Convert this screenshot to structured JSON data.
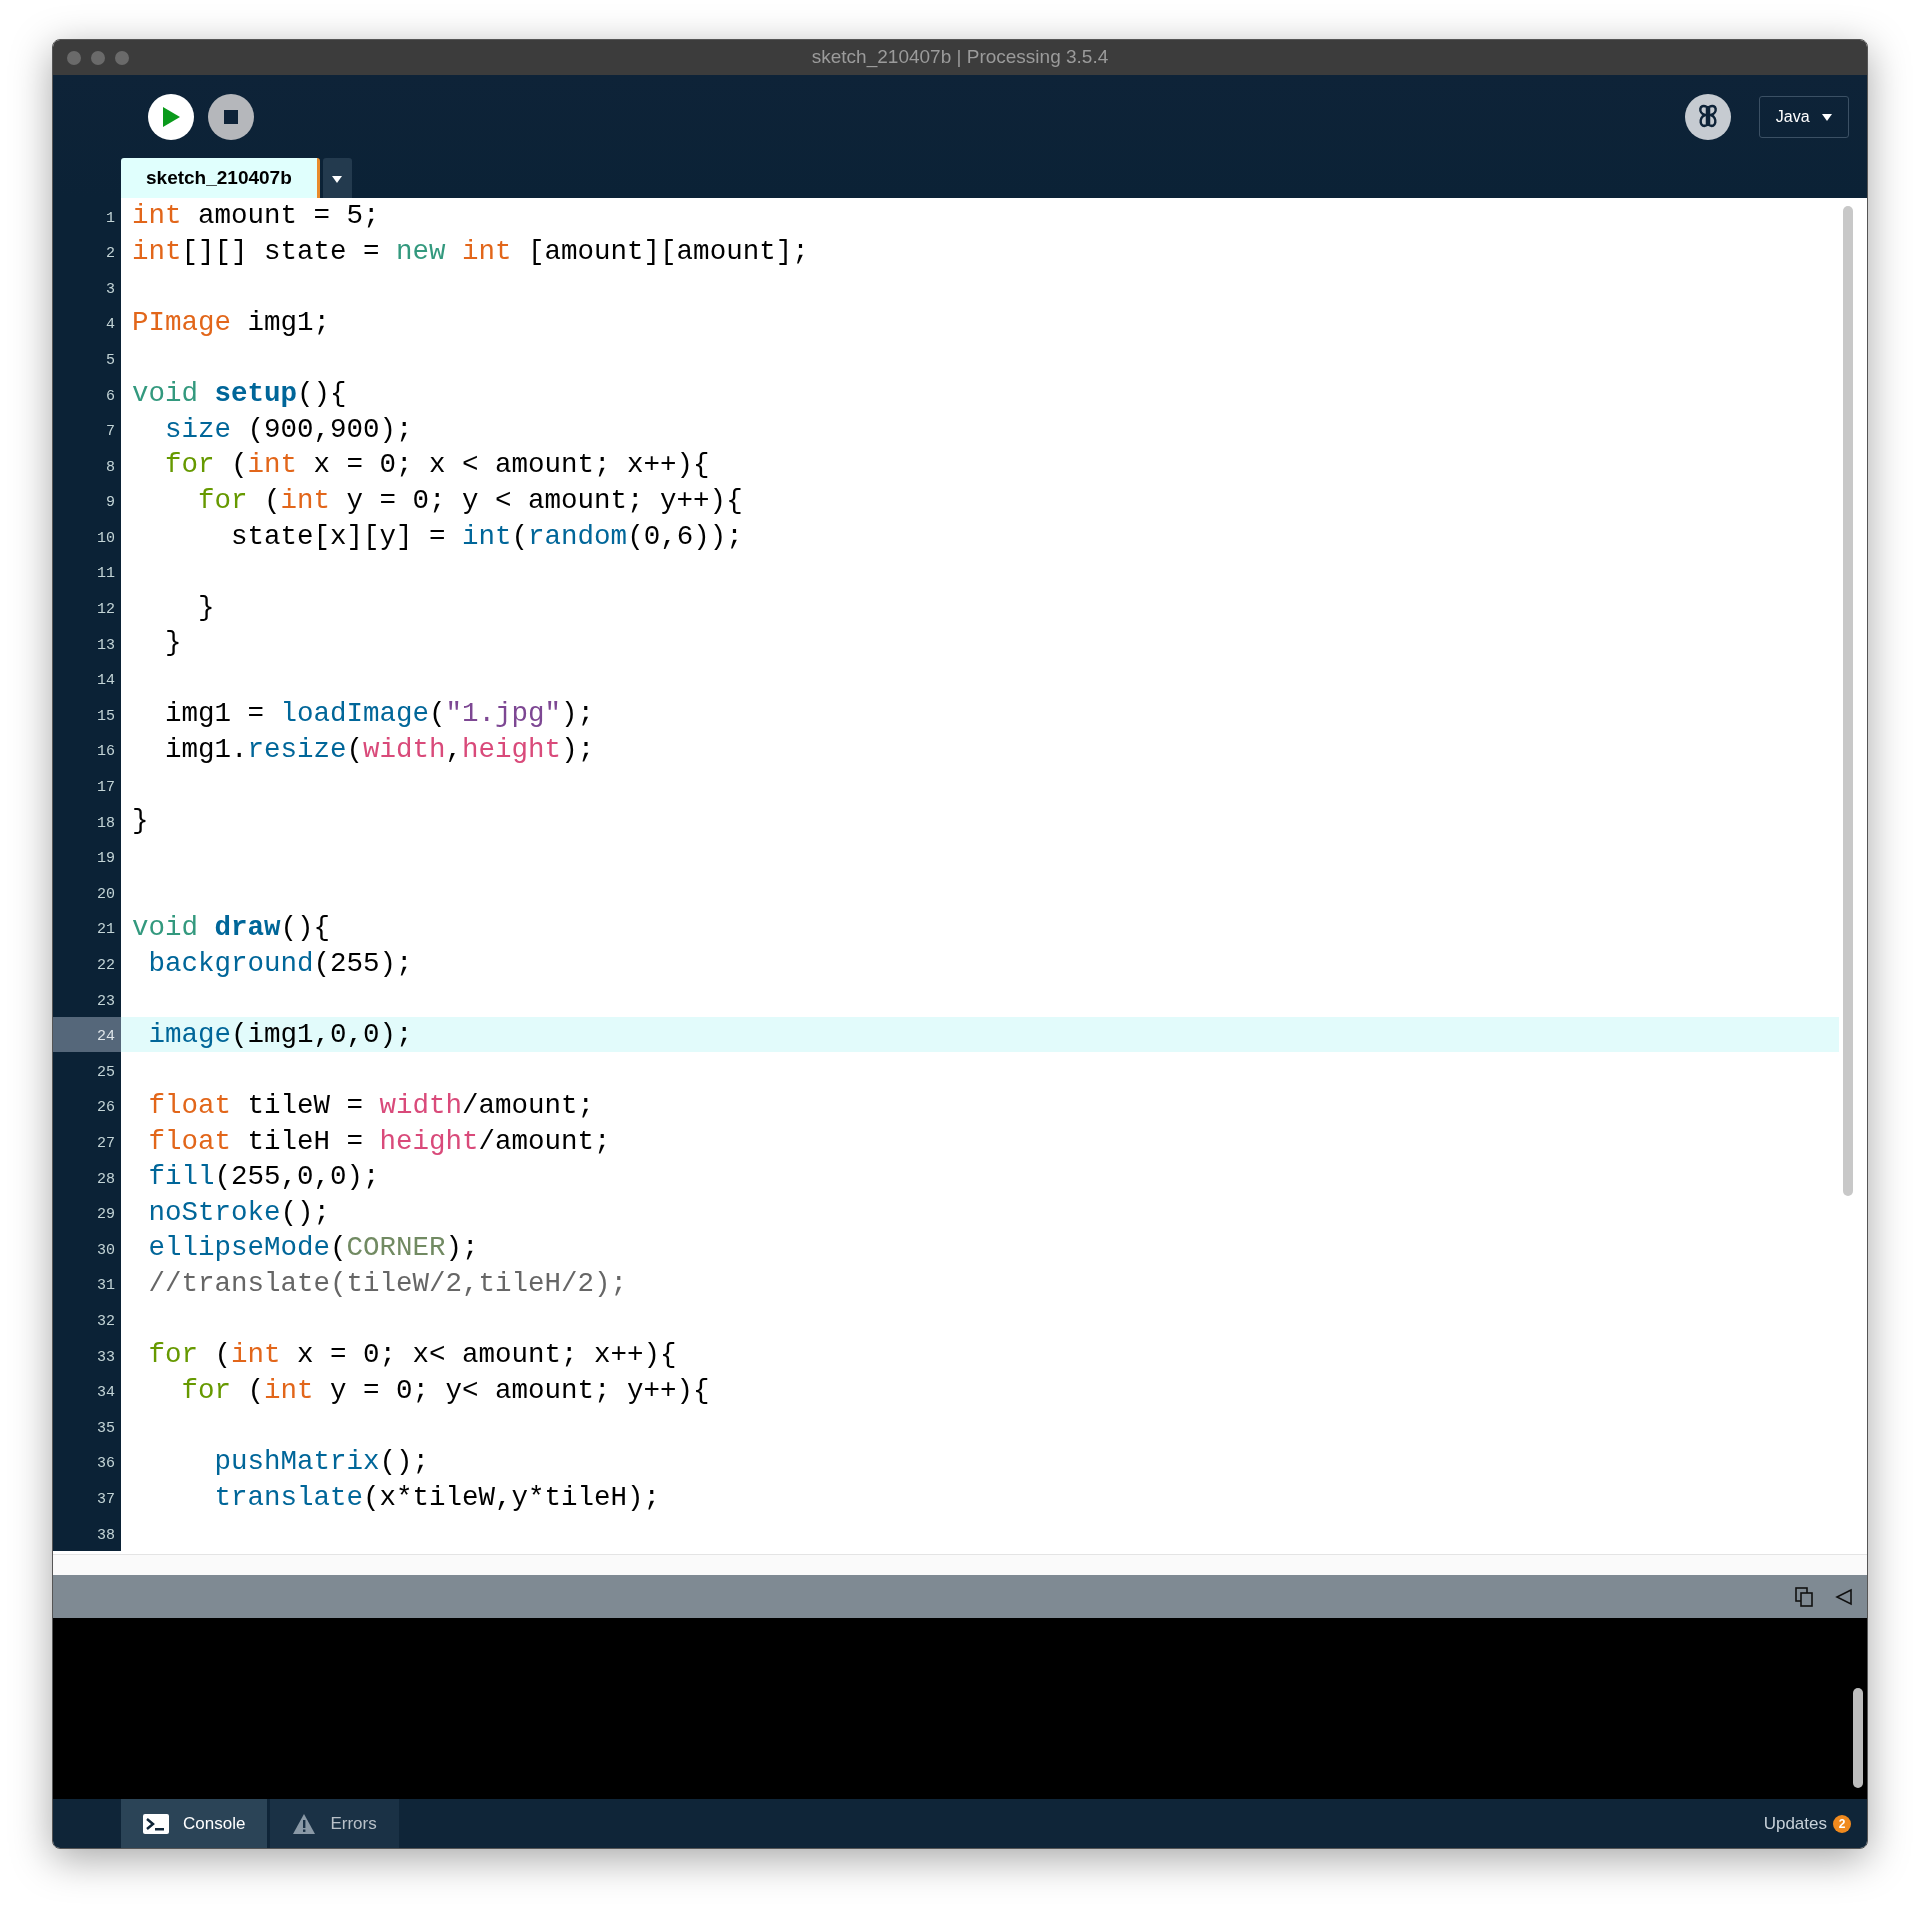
{
  "window": {
    "title": "sketch_210407b | Processing 3.5.4"
  },
  "toolbar": {
    "mode": "Java"
  },
  "tabs": [
    {
      "label": "sketch_210407b",
      "selected": true
    }
  ],
  "editor": {
    "lines": [
      {
        "number": "1",
        "current": false,
        "tokens": [
          {
            "kind": "type",
            "text": "int"
          },
          {
            "kind": "plain",
            "text": " amount = 5;"
          }
        ]
      },
      {
        "number": "2",
        "current": false,
        "tokens": [
          {
            "kind": "type",
            "text": "int"
          },
          {
            "kind": "plain",
            "text": "[][] state = "
          },
          {
            "kind": "keyword",
            "text": "new "
          },
          {
            "kind": "type",
            "text": "int"
          },
          {
            "kind": "plain",
            "text": " [amount][amount];"
          }
        ]
      },
      {
        "number": "3",
        "current": false
      },
      {
        "number": "4",
        "current": false,
        "tokens": [
          {
            "kind": "type",
            "text": "PImage"
          },
          {
            "kind": "plain",
            "text": " img1;"
          }
        ]
      },
      {
        "number": "5",
        "current": false
      },
      {
        "number": "6",
        "current": false,
        "tokens": [
          {
            "kind": "keyword",
            "text": "void "
          },
          {
            "kind": "method",
            "text": "setup"
          },
          {
            "kind": "plain",
            "text": "(){"
          }
        ]
      },
      {
        "number": "7",
        "current": false,
        "tokens": [
          {
            "kind": "function",
            "text": "  size"
          },
          {
            "kind": "plain",
            "text": " (900,900);"
          }
        ]
      },
      {
        "number": "8",
        "current": false,
        "tokens": [
          {
            "kind": "control",
            "text": "  for"
          },
          {
            "kind": "plain",
            "text": " ("
          },
          {
            "kind": "type",
            "text": "int"
          },
          {
            "kind": "plain",
            "text": " x = 0; x < amount; x++){"
          }
        ]
      },
      {
        "number": "9",
        "current": false,
        "tokens": [
          {
            "kind": "control",
            "text": "    for"
          },
          {
            "kind": "plain",
            "text": " ("
          },
          {
            "kind": "type",
            "text": "int"
          },
          {
            "kind": "plain",
            "text": " y = 0; y < amount; y++){"
          }
        ]
      },
      {
        "number": "10",
        "current": false,
        "tokens": [
          {
            "kind": "plain",
            "text": "      state[x][y] = "
          },
          {
            "kind": "function",
            "text": "int"
          },
          {
            "kind": "plain",
            "text": "("
          },
          {
            "kind": "function",
            "text": "random"
          },
          {
            "kind": "plain",
            "text": "(0,6));"
          }
        ]
      },
      {
        "number": "11",
        "current": false
      },
      {
        "number": "12",
        "current": false,
        "tokens": [
          {
            "kind": "plain",
            "text": "    }"
          }
        ]
      },
      {
        "number": "13",
        "current": false,
        "tokens": [
          {
            "kind": "plain",
            "text": "  }"
          }
        ]
      },
      {
        "number": "14",
        "current": false
      },
      {
        "number": "15",
        "current": false,
        "tokens": [
          {
            "kind": "plain",
            "text": "  img1 = "
          },
          {
            "kind": "function",
            "text": "loadImage"
          },
          {
            "kind": "plain",
            "text": "("
          },
          {
            "kind": "string",
            "text": "\"1.jpg\""
          },
          {
            "kind": "plain",
            "text": ");"
          }
        ]
      },
      {
        "number": "16",
        "current": false,
        "tokens": [
          {
            "kind": "plain",
            "text": "  img1."
          },
          {
            "kind": "function",
            "text": "resize"
          },
          {
            "kind": "plain",
            "text": "("
          },
          {
            "kind": "variable",
            "text": "width"
          },
          {
            "kind": "plain",
            "text": ","
          },
          {
            "kind": "variable",
            "text": "height"
          },
          {
            "kind": "plain",
            "text": ");"
          }
        ]
      },
      {
        "number": "17",
        "current": false
      },
      {
        "number": "18",
        "current": false,
        "tokens": [
          {
            "kind": "plain",
            "text": "}"
          }
        ]
      },
      {
        "number": "19",
        "current": false
      },
      {
        "number": "20",
        "current": false
      },
      {
        "number": "21",
        "current": false,
        "tokens": [
          {
            "kind": "keyword",
            "text": "void "
          },
          {
            "kind": "method",
            "text": "draw"
          },
          {
            "kind": "plain",
            "text": "(){"
          }
        ]
      },
      {
        "number": "22",
        "current": false,
        "tokens": [
          {
            "kind": "function",
            "text": " background"
          },
          {
            "kind": "plain",
            "text": "(255);"
          }
        ]
      },
      {
        "number": "23",
        "current": false
      },
      {
        "number": "24",
        "current": true,
        "tokens": [
          {
            "kind": "function",
            "text": " image"
          },
          {
            "kind": "plain",
            "text": "(img1,0,0);"
          }
        ]
      },
      {
        "number": "25",
        "current": false
      },
      {
        "number": "26",
        "current": false,
        "tokens": [
          {
            "kind": "type",
            "text": " float"
          },
          {
            "kind": "plain",
            "text": " tileW = "
          },
          {
            "kind": "variable",
            "text": "width"
          },
          {
            "kind": "plain",
            "text": "/amount;"
          }
        ]
      },
      {
        "number": "27",
        "current": false,
        "tokens": [
          {
            "kind": "type",
            "text": " float"
          },
          {
            "kind": "plain",
            "text": " tileH = "
          },
          {
            "kind": "variable",
            "text": "height"
          },
          {
            "kind": "plain",
            "text": "/amount;"
          }
        ]
      },
      {
        "number": "28",
        "current": false,
        "tokens": [
          {
            "kind": "function",
            "text": " fill"
          },
          {
            "kind": "plain",
            "text": "(255,0,0);"
          }
        ]
      },
      {
        "number": "29",
        "current": false,
        "tokens": [
          {
            "kind": "function",
            "text": " noStroke"
          },
          {
            "kind": "plain",
            "text": "();"
          }
        ]
      },
      {
        "number": "30",
        "current": false,
        "tokens": [
          {
            "kind": "function",
            "text": " ellipseMode"
          },
          {
            "kind": "plain",
            "text": "("
          },
          {
            "kind": "constant",
            "text": "CORNER"
          },
          {
            "kind": "plain",
            "text": ");"
          }
        ]
      },
      {
        "number": "31",
        "current": false,
        "tokens": [
          {
            "kind": "comment",
            "text": " //translate(tileW/2,tileH/2);"
          }
        ]
      },
      {
        "number": "32",
        "current": false
      },
      {
        "number": "33",
        "current": false,
        "tokens": [
          {
            "kind": "control",
            "text": " for"
          },
          {
            "kind": "plain",
            "text": " ("
          },
          {
            "kind": "type",
            "text": "int"
          },
          {
            "kind": "plain",
            "text": " x = 0; x< amount; x++){"
          }
        ]
      },
      {
        "number": "34",
        "current": false,
        "tokens": [
          {
            "kind": "control",
            "text": "   for"
          },
          {
            "kind": "plain",
            "text": " ("
          },
          {
            "kind": "type",
            "text": "int"
          },
          {
            "kind": "plain",
            "text": " y = 0; y< amount; y++){"
          }
        ]
      },
      {
        "number": "35",
        "current": false
      },
      {
        "number": "36",
        "current": false,
        "tokens": [
          {
            "kind": "function",
            "text": "     pushMatrix"
          },
          {
            "kind": "plain",
            "text": "();"
          }
        ]
      },
      {
        "number": "37",
        "current": false,
        "tokens": [
          {
            "kind": "function",
            "text": "     translate"
          },
          {
            "kind": "plain",
            "text": "(x*tileW,y*tileH);"
          }
        ]
      },
      {
        "number": "38",
        "current": false
      }
    ]
  },
  "footer": {
    "tabs": [
      {
        "kind": "console",
        "label": "Console",
        "selected": true
      },
      {
        "kind": "errors",
        "label": "Errors",
        "selected": false
      }
    ],
    "updates": {
      "label": "Updates",
      "count": "2"
    }
  }
}
